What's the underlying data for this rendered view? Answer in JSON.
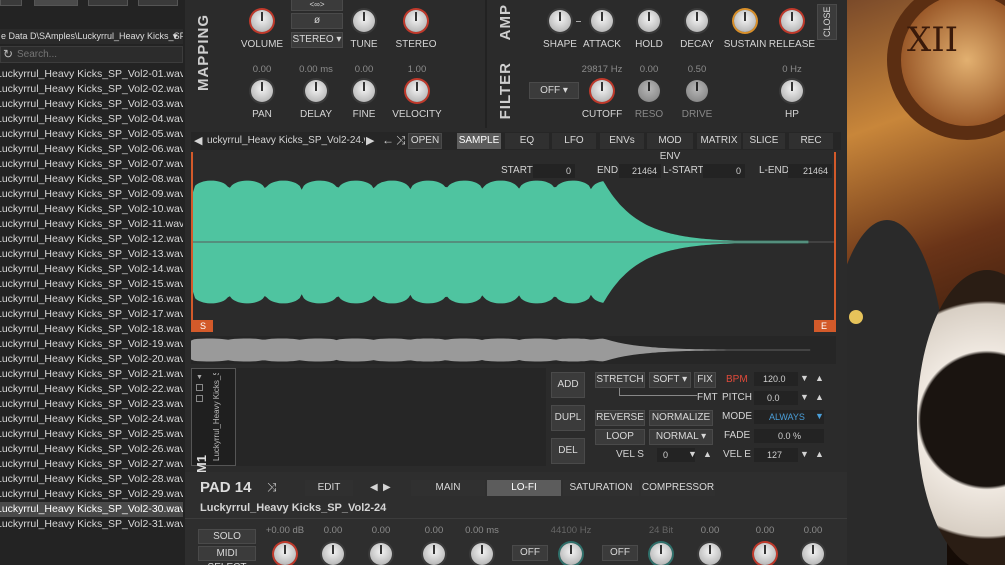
{
  "browser": {
    "tabs": [
      "",
      "",
      "",
      ""
    ],
    "path": "e Data D\\SAmples\\Luckyrrul_Heavy Kicks_SP_Vol2",
    "search_placeholder": "Search...",
    "files": [
      "Luckyrrul_Heavy Kicks_SP_Vol2-01.wav",
      "Luckyrrul_Heavy Kicks_SP_Vol2-02.wav",
      "Luckyrrul_Heavy Kicks_SP_Vol2-03.wav",
      "Luckyrrul_Heavy Kicks_SP_Vol2-04.wav",
      "Luckyrrul_Heavy Kicks_SP_Vol2-05.wav",
      "Luckyrrul_Heavy Kicks_SP_Vol2-06.wav",
      "Luckyrrul_Heavy Kicks_SP_Vol2-07.wav",
      "Luckyrrul_Heavy Kicks_SP_Vol2-08.wav",
      "Luckyrrul_Heavy Kicks_SP_Vol2-09.wav",
      "Luckyrrul_Heavy Kicks_SP_Vol2-10.wav",
      "Luckyrrul_Heavy Kicks_SP_Vol2-11.wav",
      "Luckyrrul_Heavy Kicks_SP_Vol2-12.wav",
      "Luckyrrul_Heavy Kicks_SP_Vol2-13.wav",
      "Luckyrrul_Heavy Kicks_SP_Vol2-14.wav",
      "Luckyrrul_Heavy Kicks_SP_Vol2-15.wav",
      "Luckyrrul_Heavy Kicks_SP_Vol2-16.wav",
      "Luckyrrul_Heavy Kicks_SP_Vol2-17.wav",
      "Luckyrrul_Heavy Kicks_SP_Vol2-18.wav",
      "Luckyrrul_Heavy Kicks_SP_Vol2-19.wav",
      "Luckyrrul_Heavy Kicks_SP_Vol2-20.wav",
      "Luckyrrul_Heavy Kicks_SP_Vol2-21.wav",
      "Luckyrrul_Heavy Kicks_SP_Vol2-22.wav",
      "Luckyrrul_Heavy Kicks_SP_Vol2-23.wav",
      "Luckyrrul_Heavy Kicks_SP_Vol2-24.wav",
      "Luckyrrul_Heavy Kicks_SP_Vol2-25.wav",
      "Luckyrrul_Heavy Kicks_SP_Vol2-26.wav",
      "Luckyrrul_Heavy Kicks_SP_Vol2-27.wav",
      "Luckyrrul_Heavy Kicks_SP_Vol2-28.wav",
      "Luckyrrul_Heavy Kicks_SP_Vol2-29.wav",
      "Luckyrrul_Heavy Kicks_SP_Vol2-30.wav",
      "Luckyrrul_Heavy Kicks_SP_Vol2-31.wav"
    ],
    "selected_index": 29
  },
  "mapping": {
    "title": "MAPPING",
    "link_symbol": "<∞>",
    "empty_symbol": "ø",
    "stereo_mode": "STEREO",
    "knobs_top": [
      "VOLUME",
      "TUNE",
      "STEREO"
    ],
    "values_bottom": [
      "0.00",
      "0.00 ms",
      "0.00",
      "1.00"
    ],
    "knobs_bottom": [
      "PAN",
      "DELAY",
      "FINE",
      "VELOCITY"
    ]
  },
  "amp": {
    "title": "AMP",
    "knobs": [
      "SHAPE",
      "ATTACK",
      "HOLD",
      "DECAY",
      "SUSTAIN",
      "RELEASE"
    ],
    "close": "CLOSE"
  },
  "filter": {
    "title": "FILTER",
    "mode": "OFF",
    "values": [
      "29817 Hz",
      "0.00",
      "0.50",
      "0 Hz"
    ],
    "knobs": [
      "CUTOFF",
      "RESO",
      "DRIVE",
      "HP"
    ]
  },
  "sample_bar": {
    "filename": "uckyrrul_Heavy Kicks_SP_Vol2-24.wav",
    "open": "OPEN",
    "tabs": [
      "SAMPLE",
      "EQ",
      "LFO",
      "ENVs",
      "MOD ENV",
      "MATRIX",
      "SLICE",
      "REC"
    ],
    "active_tab": "SAMPLE"
  },
  "wave_fields": {
    "start_label": "START",
    "start": "0",
    "end_label": "END",
    "end": "21464",
    "lstart_label": "L-START",
    "lstart": "0",
    "lend_label": "L-END",
    "lend": "21464",
    "marker_s": "S",
    "marker_e": "E"
  },
  "wave_color": "#4fc4a0",
  "slot": {
    "label": "M1",
    "name": "Luckyrrul_Heavy Kicks_SP_\\"
  },
  "slot_buttons": [
    "ADD",
    "DUPL",
    "DEL"
  ],
  "controls": {
    "stretch": "STRETCH",
    "soft": "SOFT",
    "fix": "FIX",
    "bpm_label": "BPM",
    "bpm": "120.0",
    "fmt": "FMT",
    "pitch_label": "PITCH",
    "pitch": "0.0",
    "reverse": "REVERSE",
    "normalize": "NORMALIZE",
    "mode_label": "MODE",
    "mode": "ALWAYS",
    "loop": "LOOP",
    "normal": "NORMAL",
    "fade_label": "FADE",
    "fade": "0.0 %",
    "vel_s_label": "VEL S",
    "vel_s": "0",
    "vel_e_label": "VEL E",
    "vel_e": "127"
  },
  "pad": {
    "title": "PAD 14",
    "edit": "EDIT",
    "tabs": [
      "MAIN",
      "LO-FI",
      "SATURATION",
      "COMPRESSOR"
    ],
    "active_tab": "LO-FI",
    "sample_name": "Luckyrrul_Heavy Kicks_SP_Vol2-24",
    "solo": "SOLO",
    "midi_select": "MIDI SELECT",
    "values": [
      "+0.00 dB",
      "0.00",
      "0.00",
      "0.00",
      "0.00 ms",
      "44100 Hz",
      "24 Bit",
      "0.00",
      "0.00",
      "0.00"
    ],
    "off1": "OFF",
    "off2": "OFF"
  }
}
